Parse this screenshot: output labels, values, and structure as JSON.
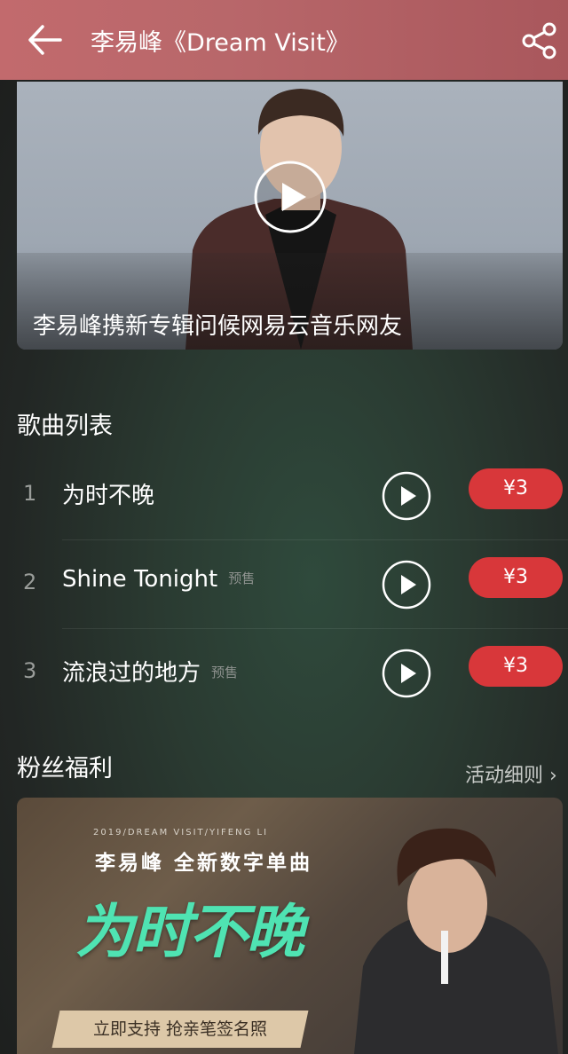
{
  "header": {
    "title": "李易峰《Dream Visit》"
  },
  "video": {
    "caption": "李易峰携新专辑问候网易云音乐网友"
  },
  "songs_section": {
    "title": "歌曲列表",
    "songs": [
      {
        "number": "1",
        "name": "为时不晚",
        "tag": "",
        "price": "¥3"
      },
      {
        "number": "2",
        "name": "Shine Tonight",
        "tag": "预售",
        "price": "¥3"
      },
      {
        "number": "3",
        "name": "流浪过的地方",
        "tag": "预售",
        "price": "¥3"
      }
    ]
  },
  "fans_section": {
    "title": "粉丝福利",
    "rules_link": "活动细则 ›"
  },
  "banner": {
    "top_text": "2019/DREAM VISIT/YIFENG LI",
    "subtitle": "李易峰 全新数字单曲",
    "art_title": "为时不晚",
    "tag": "立即支持 抢亲笔签名照"
  },
  "colors": {
    "header": "#b8676a",
    "price": "#d8373a",
    "art": "#4fe3b2"
  }
}
